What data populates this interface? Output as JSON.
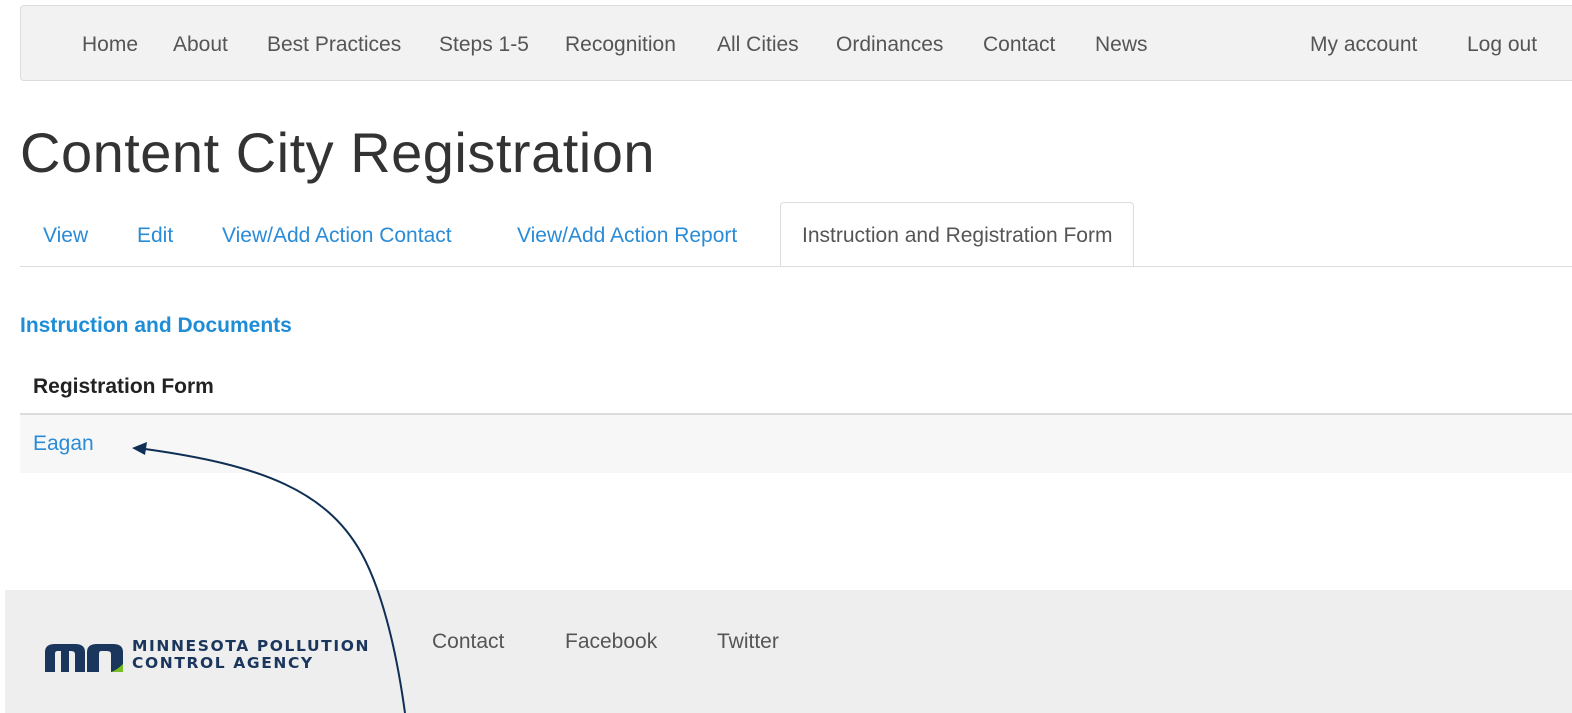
{
  "topnav": {
    "items": [
      "Home",
      "About",
      "Best Practices",
      "Steps 1-5",
      "Recognition",
      "All Cities",
      "Ordinances",
      "Contact",
      "News"
    ],
    "account_label": "My account",
    "logout_label": "Log out"
  },
  "page": {
    "title": "Content City Registration"
  },
  "tabs": [
    {
      "label": "View",
      "active": false
    },
    {
      "label": "Edit",
      "active": false
    },
    {
      "label": "View/Add Action Contact",
      "active": false
    },
    {
      "label": "View/Add Action Report",
      "active": false
    },
    {
      "label": "Instruction and Registration Form",
      "active": true
    }
  ],
  "content": {
    "section_heading": "Instruction and Documents",
    "table": {
      "header": "Registration Form",
      "rows": [
        "Eagan"
      ]
    }
  },
  "footer": {
    "logo_line1": "MINNESOTA POLLUTION",
    "logo_line2": "CONTROL AGENCY",
    "links": [
      "Contact",
      "Facebook",
      "Twitter"
    ]
  },
  "colors": {
    "link": "#2a8bd6",
    "heading_accent": "#1f8dd6",
    "logo_navy": "#1b365d",
    "annotation_arrow": "#0f2f55"
  }
}
